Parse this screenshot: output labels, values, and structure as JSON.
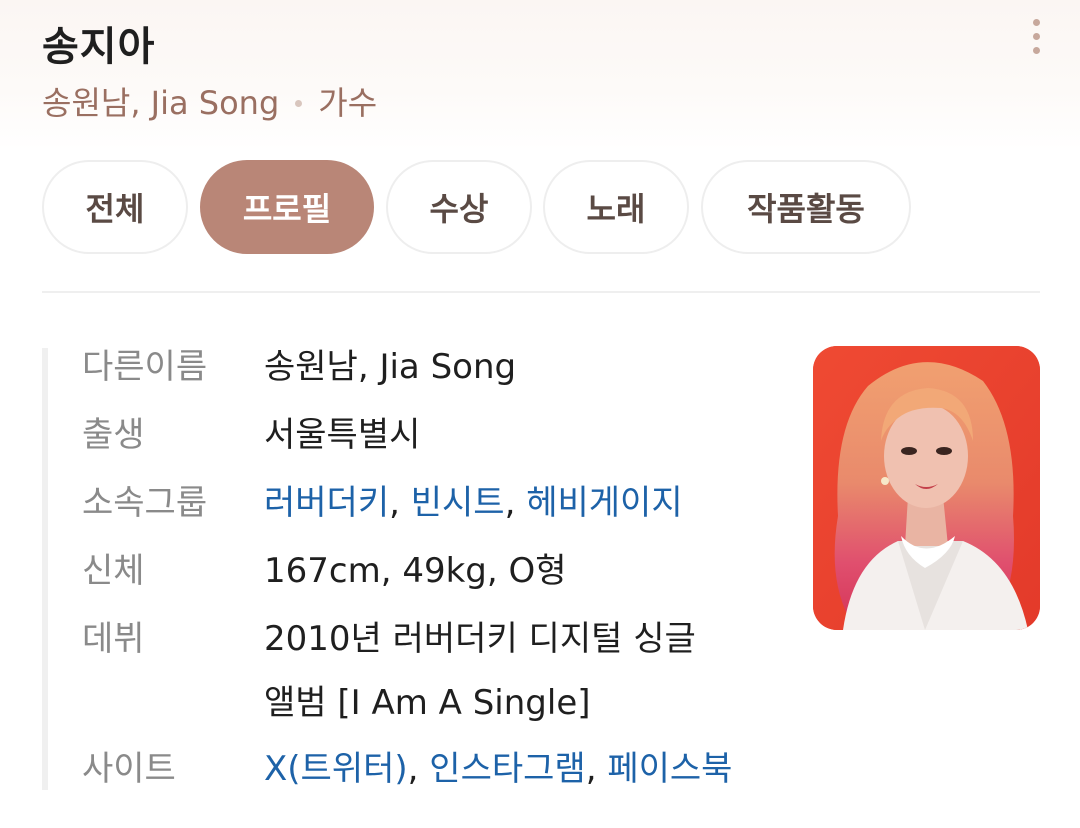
{
  "header": {
    "title": "송지아",
    "aliases": "송원남, Jia Song",
    "occupation": "가수",
    "more_icon": "more-vertical-icon"
  },
  "tabs": [
    {
      "label": "전체",
      "active": false
    },
    {
      "label": "프로필",
      "active": true
    },
    {
      "label": "수상",
      "active": false
    },
    {
      "label": "노래",
      "active": false
    },
    {
      "label": "작품활동",
      "active": false
    }
  ],
  "profile": {
    "other_names": {
      "label": "다른이름",
      "value": "송원남, Jia Song"
    },
    "birth": {
      "label": "출생",
      "value": "서울특별시"
    },
    "groups": {
      "label": "소속그룹",
      "links": [
        "러버더키",
        "빈시트",
        "헤비게이지"
      ],
      "separator": ","
    },
    "body": {
      "label": "신체",
      "value": "167cm, 49kg, O형"
    },
    "debut": {
      "label": "데뷔",
      "line1": "2010년 러버더키 디지털 싱글",
      "line2": "앨범 [I Am A Single]"
    },
    "sites": {
      "label": "사이트",
      "links": [
        "X(트위터)",
        "인스타그램",
        "페이스북"
      ],
      "separator": ","
    }
  },
  "colors": {
    "accent": "#b98677",
    "link": "#1d62a8",
    "subtitle": "#9a6f61",
    "photo_background": "#e9402d"
  }
}
